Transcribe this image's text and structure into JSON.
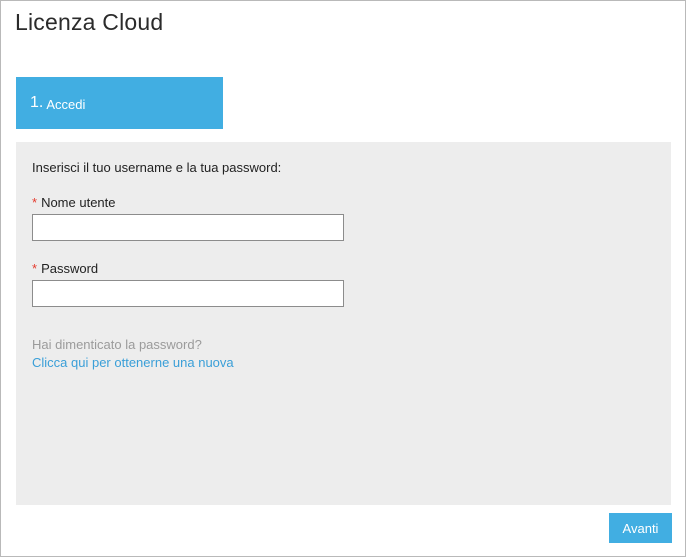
{
  "app": {
    "title": "Licenza Cloud"
  },
  "steps": [
    {
      "number": "1.",
      "label": "Accedi",
      "active": true
    }
  ],
  "form": {
    "intro": "Inserisci il tuo username e la tua password:",
    "required_marker": "*",
    "username": {
      "label": "Nome utente",
      "value": "",
      "placeholder": ""
    },
    "password": {
      "label": "Password",
      "value": "",
      "placeholder": ""
    },
    "forgot_text": "Hai dimenticato la password?",
    "forgot_link": "Clicca qui per ottenerne una nuova"
  },
  "actions": {
    "next_label": "Avanti"
  },
  "colors": {
    "accent": "#41aee2",
    "panel_bg": "#ededed",
    "required": "#e53a2d",
    "link": "#3a9fd8",
    "muted": "#9b9b9b"
  }
}
